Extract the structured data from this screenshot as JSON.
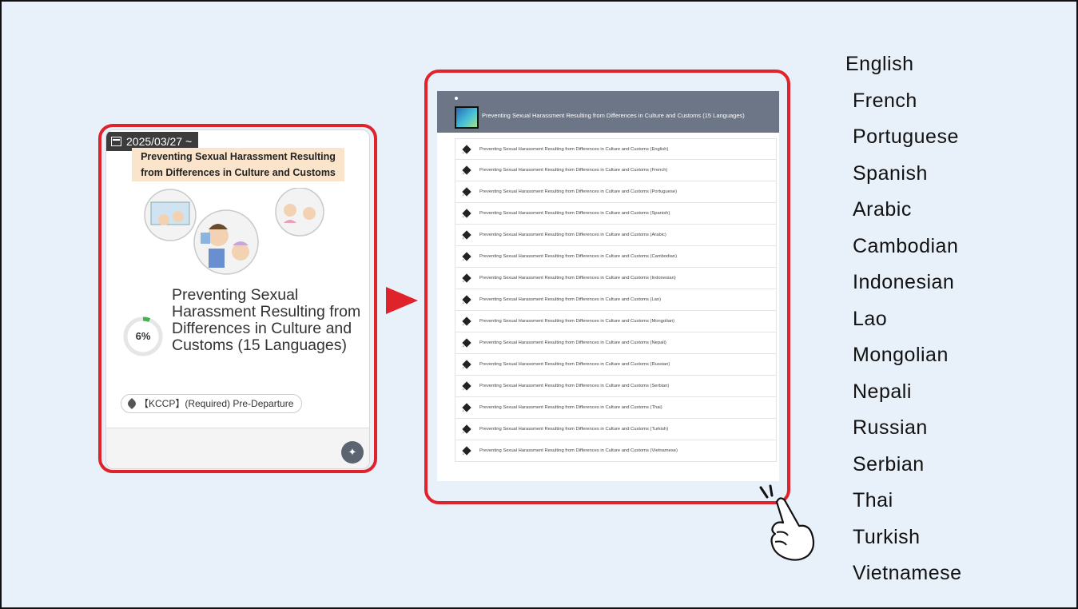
{
  "card": {
    "date": "2025/03/27 ~",
    "thumbnail_title": "Preventing Sexual Harassment Resulting from Differences in Culture and Customs",
    "progress": "6%",
    "progress_fraction": 0.06,
    "title": "Preventing Sexual Harassment Resulting from Differences in Culture and Customs (15 Languages)",
    "tag": "【KCCP】(Required) Pre-Departure",
    "icons": [
      "calendar-icon",
      "tag-icon",
      "pin-icon"
    ]
  },
  "panel": {
    "header_title": "Preventing Sexual Harassment Resulting from Differences in Culture and Customs (15 Languages)",
    "items": [
      "Preventing Sexual Harassment Resulting from Differences in Culture and Customs (English)",
      "Preventing Sexual Harassment Resulting from Differences in Culture and Customs (French)",
      "Preventing Sexual Harassment Resulting from Differences in Culture and Customs (Portuguese)",
      "Preventing Sexual Harassment Resulting from Differences in Culture and Customs (Spanish)",
      "Preventing Sexual Harassment Resulting from Differences in Culture and Customs (Arabic)",
      "Preventing Sexual Harassment Resulting from Differences in Culture and Customs (Cambodian)",
      "Preventing Sexual Harassment Resulting from Differences in Culture and Customs (Indonesian)",
      "Preventing Sexual Harassment Resulting from Differences in Culture and Customs (Lao)",
      "Preventing Sexual Harassment Resulting from Differences in Culture and Customs (Mongolian)",
      "Preventing Sexual Harassment Resulting from Differences in Culture and Customs (Nepali)",
      "Preventing Sexual Harassment Resulting from Differences in Culture and Customs (Russian)",
      "Preventing Sexual Harassment Resulting from Differences in Culture and Customs (Serbian)",
      "Preventing Sexual Harassment Resulting from Differences in Culture and Customs (Thai)",
      "Preventing Sexual Harassment Resulting from Differences in Culture and Customs (Turkish)",
      "Preventing Sexual Harassment Resulting from Differences in Culture and Customs (Vietnamese)"
    ]
  },
  "languages": [
    "English",
    "French",
    "Portuguese",
    "Spanish",
    "Arabic",
    "Cambodian",
    "Indonesian",
    "Lao",
    "Mongolian",
    "Nepali",
    "Russian",
    "Serbian",
    "Thai",
    "Turkish",
    "Vietnamese"
  ],
  "colors": {
    "highlight_red": "#e0222a",
    "background": "#e8f0f9",
    "panel_header": "#6c7686",
    "progress_green": "#3cb54a"
  }
}
